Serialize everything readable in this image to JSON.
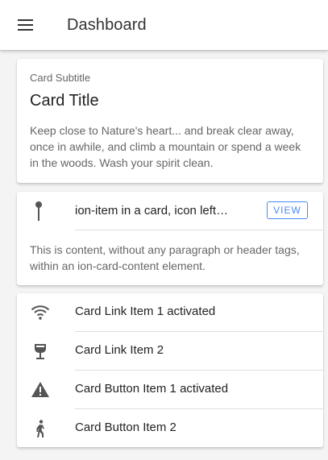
{
  "toolbar": {
    "menu_icon": "menu-icon",
    "title": "Dashboard"
  },
  "card1": {
    "subtitle": "Card Subtitle",
    "title": "Card Title",
    "body": "Keep close to Nature's heart... and break clear away, once in awhile, and climb a mountain or spend a week in the woods. Wash your spirit clean."
  },
  "card2": {
    "icon": "pin-icon",
    "item_label": "ion-item in a card, icon left…",
    "button_label": "VIEW",
    "accent": "#4a8af4",
    "body": "This is content, without any paragraph or header tags, within an ion-card-content element."
  },
  "card3": {
    "items": [
      {
        "icon": "wifi-icon",
        "label": "Card Link Item 1 activated"
      },
      {
        "icon": "wine-icon",
        "label": "Card Link Item 2"
      },
      {
        "icon": "warning-icon",
        "label": "Card Button Item 1 activated"
      },
      {
        "icon": "walk-icon",
        "label": "Card Button Item 2"
      }
    ]
  }
}
